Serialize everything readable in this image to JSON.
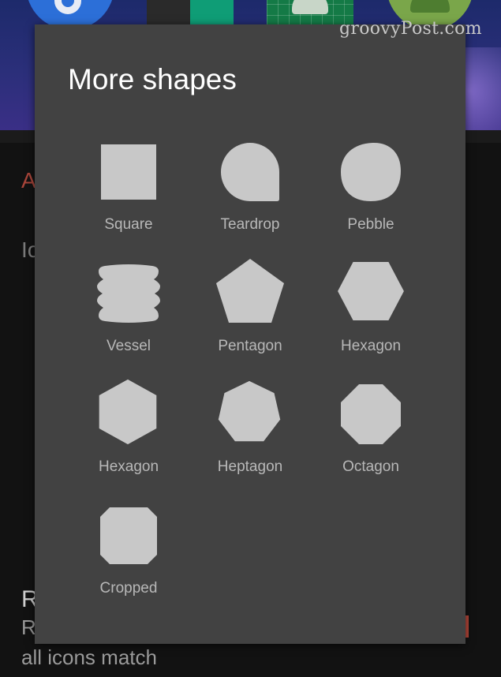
{
  "watermark": "groovyPost.com",
  "background": {
    "accent_char": "A",
    "icon_char": "Ic",
    "title_char": "R",
    "sub_char": "R",
    "description_fragment": "all icons match"
  },
  "dialog": {
    "title": "More shapes",
    "shapes": [
      {
        "label": "Square",
        "icon": "square-shape-icon"
      },
      {
        "label": "Teardrop",
        "icon": "teardrop-shape-icon"
      },
      {
        "label": "Pebble",
        "icon": "pebble-shape-icon"
      },
      {
        "label": "Vessel",
        "icon": "vessel-shape-icon"
      },
      {
        "label": "Pentagon",
        "icon": "pentagon-shape-icon"
      },
      {
        "label": "Hexagon",
        "icon": "hexagon-horizontal-shape-icon"
      },
      {
        "label": "Hexagon",
        "icon": "hexagon-vertical-shape-icon"
      },
      {
        "label": "Heptagon",
        "icon": "heptagon-shape-icon"
      },
      {
        "label": "Octagon",
        "icon": "octagon-shape-icon"
      },
      {
        "label": "Cropped",
        "icon": "cropped-shape-icon"
      }
    ]
  },
  "colors": {
    "dialog_background": "#424242",
    "shape_fill": "#c8c8c8",
    "label_text": "#b8b8b8",
    "title_text": "#ffffff",
    "accent": "#a8453a"
  }
}
